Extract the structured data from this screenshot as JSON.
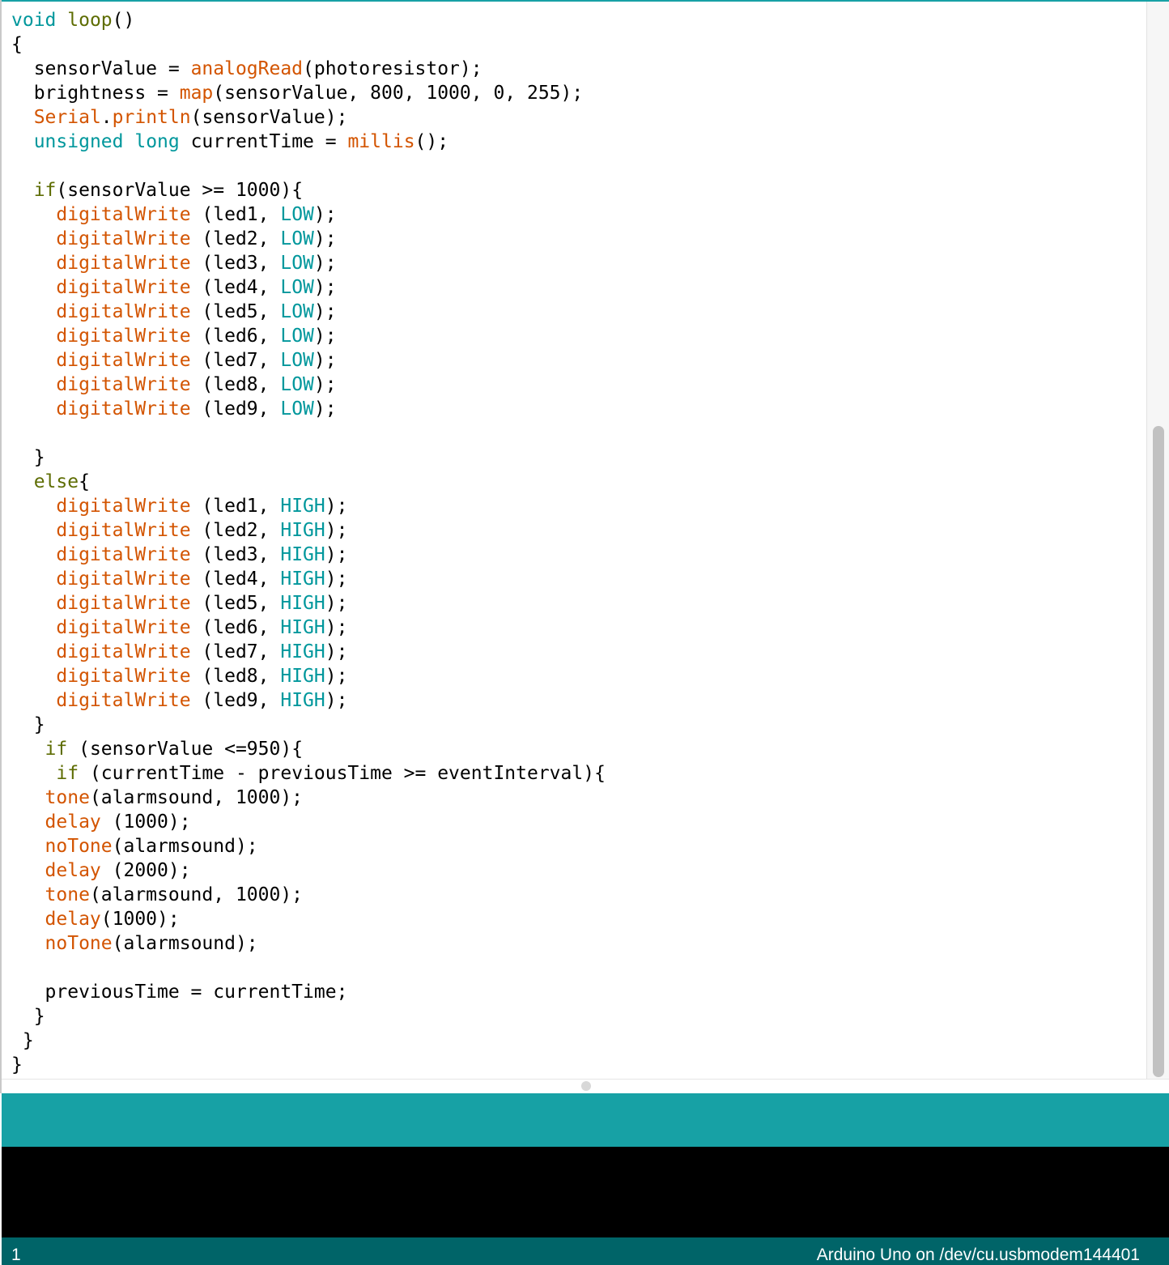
{
  "editor": {
    "lines": [
      [
        {
          "t": "void",
          "c": "keyword"
        },
        {
          "t": " ",
          "c": "plain"
        },
        {
          "t": "loop",
          "c": "fname"
        },
        {
          "t": "()",
          "c": "plain"
        }
      ],
      [
        {
          "t": "{",
          "c": "plain"
        }
      ],
      [
        {
          "t": "  sensorValue = ",
          "c": "plain"
        },
        {
          "t": "analogRead",
          "c": "function"
        },
        {
          "t": "(photoresistor);",
          "c": "plain"
        }
      ],
      [
        {
          "t": "  brightness = ",
          "c": "plain"
        },
        {
          "t": "map",
          "c": "function"
        },
        {
          "t": "(sensorValue, 800, 1000, 0, 255);",
          "c": "plain"
        }
      ],
      [
        {
          "t": "  ",
          "c": "plain"
        },
        {
          "t": "Serial",
          "c": "function"
        },
        {
          "t": ".",
          "c": "plain"
        },
        {
          "t": "println",
          "c": "function"
        },
        {
          "t": "(sensorValue);",
          "c": "plain"
        }
      ],
      [
        {
          "t": "  ",
          "c": "plain"
        },
        {
          "t": "unsigned",
          "c": "keyword"
        },
        {
          "t": " ",
          "c": "plain"
        },
        {
          "t": "long",
          "c": "keyword"
        },
        {
          "t": " currentTime = ",
          "c": "plain"
        },
        {
          "t": "millis",
          "c": "function"
        },
        {
          "t": "();",
          "c": "plain"
        }
      ],
      [],
      [
        {
          "t": "  ",
          "c": "plain"
        },
        {
          "t": "if",
          "c": "control"
        },
        {
          "t": "(sensorValue >= 1000){",
          "c": "plain"
        }
      ],
      [
        {
          "t": "    ",
          "c": "plain"
        },
        {
          "t": "digitalWrite",
          "c": "function"
        },
        {
          "t": " (led1, ",
          "c": "plain"
        },
        {
          "t": "LOW",
          "c": "constant"
        },
        {
          "t": ");",
          "c": "plain"
        }
      ],
      [
        {
          "t": "    ",
          "c": "plain"
        },
        {
          "t": "digitalWrite",
          "c": "function"
        },
        {
          "t": " (led2, ",
          "c": "plain"
        },
        {
          "t": "LOW",
          "c": "constant"
        },
        {
          "t": ");",
          "c": "plain"
        }
      ],
      [
        {
          "t": "    ",
          "c": "plain"
        },
        {
          "t": "digitalWrite",
          "c": "function"
        },
        {
          "t": " (led3, ",
          "c": "plain"
        },
        {
          "t": "LOW",
          "c": "constant"
        },
        {
          "t": ");",
          "c": "plain"
        }
      ],
      [
        {
          "t": "    ",
          "c": "plain"
        },
        {
          "t": "digitalWrite",
          "c": "function"
        },
        {
          "t": " (led4, ",
          "c": "plain"
        },
        {
          "t": "LOW",
          "c": "constant"
        },
        {
          "t": ");",
          "c": "plain"
        }
      ],
      [
        {
          "t": "    ",
          "c": "plain"
        },
        {
          "t": "digitalWrite",
          "c": "function"
        },
        {
          "t": " (led5, ",
          "c": "plain"
        },
        {
          "t": "LOW",
          "c": "constant"
        },
        {
          "t": ");",
          "c": "plain"
        }
      ],
      [
        {
          "t": "    ",
          "c": "plain"
        },
        {
          "t": "digitalWrite",
          "c": "function"
        },
        {
          "t": " (led6, ",
          "c": "plain"
        },
        {
          "t": "LOW",
          "c": "constant"
        },
        {
          "t": ");",
          "c": "plain"
        }
      ],
      [
        {
          "t": "    ",
          "c": "plain"
        },
        {
          "t": "digitalWrite",
          "c": "function"
        },
        {
          "t": " (led7, ",
          "c": "plain"
        },
        {
          "t": "LOW",
          "c": "constant"
        },
        {
          "t": ");",
          "c": "plain"
        }
      ],
      [
        {
          "t": "    ",
          "c": "plain"
        },
        {
          "t": "digitalWrite",
          "c": "function"
        },
        {
          "t": " (led8, ",
          "c": "plain"
        },
        {
          "t": "LOW",
          "c": "constant"
        },
        {
          "t": ");",
          "c": "plain"
        }
      ],
      [
        {
          "t": "    ",
          "c": "plain"
        },
        {
          "t": "digitalWrite",
          "c": "function"
        },
        {
          "t": " (led9, ",
          "c": "plain"
        },
        {
          "t": "LOW",
          "c": "constant"
        },
        {
          "t": ");",
          "c": "plain"
        }
      ],
      [],
      [
        {
          "t": "  }",
          "c": "plain"
        }
      ],
      [
        {
          "t": "  ",
          "c": "plain"
        },
        {
          "t": "else",
          "c": "control"
        },
        {
          "t": "{",
          "c": "plain"
        }
      ],
      [
        {
          "t": "    ",
          "c": "plain"
        },
        {
          "t": "digitalWrite",
          "c": "function"
        },
        {
          "t": " (led1, ",
          "c": "plain"
        },
        {
          "t": "HIGH",
          "c": "constant"
        },
        {
          "t": ");",
          "c": "plain"
        }
      ],
      [
        {
          "t": "    ",
          "c": "plain"
        },
        {
          "t": "digitalWrite",
          "c": "function"
        },
        {
          "t": " (led2, ",
          "c": "plain"
        },
        {
          "t": "HIGH",
          "c": "constant"
        },
        {
          "t": ");",
          "c": "plain"
        }
      ],
      [
        {
          "t": "    ",
          "c": "plain"
        },
        {
          "t": "digitalWrite",
          "c": "function"
        },
        {
          "t": " (led3, ",
          "c": "plain"
        },
        {
          "t": "HIGH",
          "c": "constant"
        },
        {
          "t": ");",
          "c": "plain"
        }
      ],
      [
        {
          "t": "    ",
          "c": "plain"
        },
        {
          "t": "digitalWrite",
          "c": "function"
        },
        {
          "t": " (led4, ",
          "c": "plain"
        },
        {
          "t": "HIGH",
          "c": "constant"
        },
        {
          "t": ");",
          "c": "plain"
        }
      ],
      [
        {
          "t": "    ",
          "c": "plain"
        },
        {
          "t": "digitalWrite",
          "c": "function"
        },
        {
          "t": " (led5, ",
          "c": "plain"
        },
        {
          "t": "HIGH",
          "c": "constant"
        },
        {
          "t": ");",
          "c": "plain"
        }
      ],
      [
        {
          "t": "    ",
          "c": "plain"
        },
        {
          "t": "digitalWrite",
          "c": "function"
        },
        {
          "t": " (led6, ",
          "c": "plain"
        },
        {
          "t": "HIGH",
          "c": "constant"
        },
        {
          "t": ");",
          "c": "plain"
        }
      ],
      [
        {
          "t": "    ",
          "c": "plain"
        },
        {
          "t": "digitalWrite",
          "c": "function"
        },
        {
          "t": " (led7, ",
          "c": "plain"
        },
        {
          "t": "HIGH",
          "c": "constant"
        },
        {
          "t": ");",
          "c": "plain"
        }
      ],
      [
        {
          "t": "    ",
          "c": "plain"
        },
        {
          "t": "digitalWrite",
          "c": "function"
        },
        {
          "t": " (led8, ",
          "c": "plain"
        },
        {
          "t": "HIGH",
          "c": "constant"
        },
        {
          "t": ");",
          "c": "plain"
        }
      ],
      [
        {
          "t": "    ",
          "c": "plain"
        },
        {
          "t": "digitalWrite",
          "c": "function"
        },
        {
          "t": " (led9, ",
          "c": "plain"
        },
        {
          "t": "HIGH",
          "c": "constant"
        },
        {
          "t": ");",
          "c": "plain"
        }
      ],
      [
        {
          "t": "  }",
          "c": "plain"
        }
      ],
      [
        {
          "t": "   ",
          "c": "plain"
        },
        {
          "t": "if",
          "c": "control"
        },
        {
          "t": " (sensorValue <=950){",
          "c": "plain"
        }
      ],
      [
        {
          "t": "    ",
          "c": "plain"
        },
        {
          "t": "if",
          "c": "control"
        },
        {
          "t": " (currentTime - previousTime >= eventInterval){",
          "c": "plain"
        }
      ],
      [
        {
          "t": "   ",
          "c": "plain"
        },
        {
          "t": "tone",
          "c": "function"
        },
        {
          "t": "(alarmsound, 1000);",
          "c": "plain"
        }
      ],
      [
        {
          "t": "   ",
          "c": "plain"
        },
        {
          "t": "delay",
          "c": "function"
        },
        {
          "t": " (1000);",
          "c": "plain"
        }
      ],
      [
        {
          "t": "   ",
          "c": "plain"
        },
        {
          "t": "noTone",
          "c": "function"
        },
        {
          "t": "(alarmsound);",
          "c": "plain"
        }
      ],
      [
        {
          "t": "   ",
          "c": "plain"
        },
        {
          "t": "delay",
          "c": "function"
        },
        {
          "t": " (2000);",
          "c": "plain"
        }
      ],
      [
        {
          "t": "   ",
          "c": "plain"
        },
        {
          "t": "tone",
          "c": "function"
        },
        {
          "t": "(alarmsound, 1000);",
          "c": "plain"
        }
      ],
      [
        {
          "t": "   ",
          "c": "plain"
        },
        {
          "t": "delay",
          "c": "function"
        },
        {
          "t": "(1000);",
          "c": "plain"
        }
      ],
      [
        {
          "t": "   ",
          "c": "plain"
        },
        {
          "t": "noTone",
          "c": "function"
        },
        {
          "t": "(alarmsound);",
          "c": "plain"
        }
      ],
      [],
      [
        {
          "t": "   previousTime = currentTime;",
          "c": "plain"
        }
      ],
      [
        {
          "t": "  }",
          "c": "plain"
        }
      ],
      [
        {
          "t": " }",
          "c": "plain"
        }
      ],
      [
        {
          "t": "}",
          "c": "plain"
        }
      ]
    ]
  },
  "message_bar": {
    "text": ""
  },
  "console": {
    "text": ""
  },
  "status_bar": {
    "line_number": "1",
    "board_port": "Arduino Uno on /dev/cu.usbmodem144401"
  },
  "colors": {
    "accent": "#17a1a5",
    "status_bar": "#006468",
    "console_background": "#000000",
    "keyword": "#00979c",
    "function": "#d35400",
    "control": "#5e6d03"
  }
}
